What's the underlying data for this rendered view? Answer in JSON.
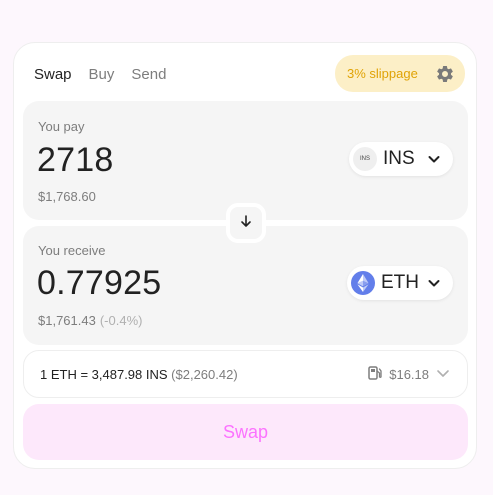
{
  "tabs": [
    {
      "label": "Swap",
      "active": true
    },
    {
      "label": "Buy",
      "active": false
    },
    {
      "label": "Send",
      "active": false
    }
  ],
  "slippage": {
    "label": "3% slippage",
    "icon": "gear-icon"
  },
  "pay": {
    "label": "You pay",
    "amount": "2718",
    "usd_value": "$1,768.60",
    "token": {
      "symbol": "INS",
      "icon_text": "INS"
    }
  },
  "switch": {
    "icon": "arrow-down-icon"
  },
  "receive": {
    "label": "You receive",
    "amount": "0.77925",
    "usd_value": "$1,761.43",
    "price_impact": "(-0.4%)",
    "token": {
      "symbol": "ETH",
      "icon": "ethereum-icon"
    }
  },
  "rate": {
    "text": "1 ETH = 3,487.98 INS",
    "usd": "($2,260.42)",
    "gas_cost": "$16.18",
    "gas_icon": "fuel-pump-icon"
  },
  "action": {
    "label": "Swap"
  },
  "colors": {
    "accent_pink": "#fc72ff",
    "swap_button_bg": "#fde8fb",
    "slippage_bg": "#fcefc7",
    "slippage_text": "#e0a306",
    "eth_blue": "#627eea"
  }
}
